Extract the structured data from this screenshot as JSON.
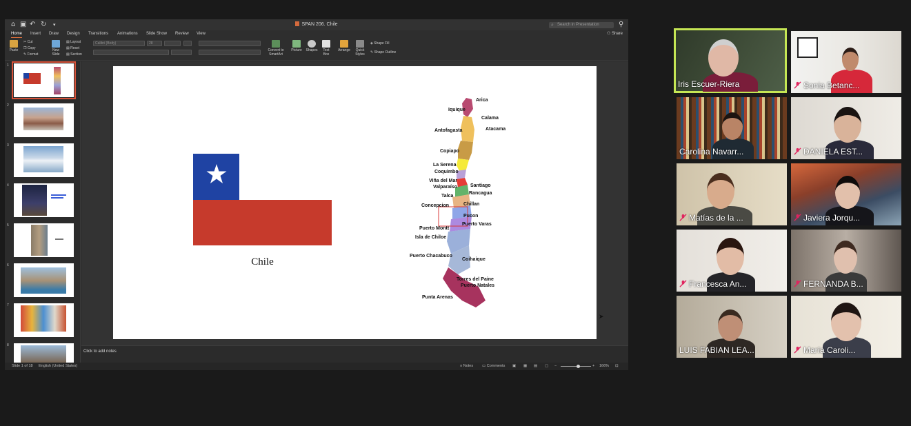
{
  "app": {
    "doc_title": "SPAN 206. Chile",
    "search_placeholder": "Search in Presentation",
    "tabs": [
      "Home",
      "Insert",
      "Draw",
      "Design",
      "Transitions",
      "Animations",
      "Slide Show",
      "Review",
      "View"
    ],
    "active_tab": "Home",
    "share_label": "Share"
  },
  "ribbon": {
    "paste": "Paste",
    "cut": "Cut",
    "copy": "Copy",
    "format": "Format",
    "new_slide": "New Slide",
    "layout": "Layout",
    "reset": "Reset",
    "section": "Section",
    "font_name": "Calibri (Body)",
    "font_size": "28",
    "convert_smartart": "Convert to SmartArt",
    "picture": "Picture",
    "shapes": "Shapes",
    "text_box": "Text Box",
    "arrange": "Arrange",
    "quick_styles": "Quick Styles",
    "shape_fill": "Shape Fill",
    "shape_outline": "Shape Outline"
  },
  "thumbnails": [
    {
      "num": "1"
    },
    {
      "num": "2"
    },
    {
      "num": "3"
    },
    {
      "num": "4"
    },
    {
      "num": "5"
    },
    {
      "num": "6"
    },
    {
      "num": "7"
    },
    {
      "num": "8"
    }
  ],
  "slide": {
    "caption": "Chile",
    "cities": [
      "Arica",
      "Iquique",
      "Calama",
      "Antofagasta",
      "Atacama",
      "Copiapo",
      "La Serena",
      "Coquimbo",
      "Viña del Mar",
      "Valparaíso",
      "Santiago",
      "Rancagua",
      "Talca",
      "Concepcion",
      "Chillan",
      "Pucon",
      "Puerto Montt",
      "Puerto Varas",
      "Isla de Chiloe",
      "Puerto Chacabuco",
      "Coihaique",
      "Torres del Paine",
      "Puerto Natales",
      "Punta Arenas"
    ]
  },
  "notes_placeholder": "Click to add notes",
  "status": {
    "slide_of": "Slide 1 of 18",
    "language": "English (United States)",
    "notes": "Notes",
    "comments": "Comments",
    "zoom": "166%"
  },
  "participants": [
    {
      "name": "Iris Escuer-Riera",
      "muted": false,
      "speaking": true
    },
    {
      "name": "Sonia Betanc...",
      "muted": true,
      "speaking": false
    },
    {
      "name": "Carolina Navarr...",
      "muted": false,
      "speaking": false
    },
    {
      "name": "DANIELA EST...",
      "muted": true,
      "speaking": false
    },
    {
      "name": "Matías de la ...",
      "muted": true,
      "speaking": false
    },
    {
      "name": "Javiera Jorqu...",
      "muted": true,
      "speaking": false
    },
    {
      "name": "Francesca An...",
      "muted": true,
      "speaking": false
    },
    {
      "name": "FERNANDA B...",
      "muted": true,
      "speaking": false
    },
    {
      "name": "LUIS FABIAN LEA...",
      "muted": false,
      "speaking": false
    },
    {
      "name": "María Caroli...",
      "muted": true,
      "speaking": false
    }
  ]
}
